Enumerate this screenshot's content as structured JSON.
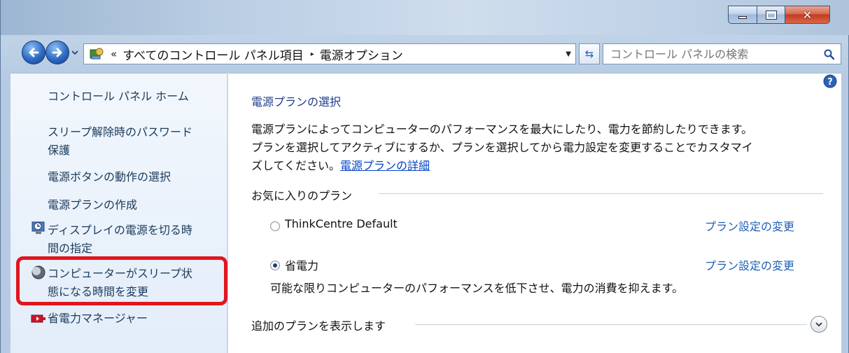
{
  "window": {
    "caption_buttons": [
      "minimize",
      "maximize",
      "close"
    ]
  },
  "address_bar": {
    "overflow_chevron": "«",
    "breadcrumbs": [
      "すべてのコントロール パネル項目",
      "電源オプション"
    ],
    "separator": "▸"
  },
  "search": {
    "placeholder": "コントロール パネルの検索"
  },
  "sidebar": {
    "items": [
      {
        "label": "コントロール パネル ホーム"
      },
      {
        "label_line1": "スリープ解除時のパスワード",
        "label_line2": "保護"
      },
      {
        "label": "電源ボタンの動作の選択"
      },
      {
        "label": "電源プランの作成"
      },
      {
        "label_line1": "ディスプレイの電源を切る時",
        "label_line2": "間の指定",
        "icon": "display-clock-icon"
      },
      {
        "label_line1": "コンピューターがスリープ状",
        "label_line2": "態になる時間を変更",
        "icon": "moon-sleep-icon",
        "highlighted": true
      },
      {
        "label": "省電力マネージャー",
        "icon": "battery-manager-icon"
      }
    ]
  },
  "main": {
    "title": "電源プランの選択",
    "description_line1": "電源プランによってコンピューターのパフォーマンスを最大にしたり、電力を節約したりできます。",
    "description_line2": "プランを選択してアクティブにするか、プランを選択してから電力設定を変更することでカスタマイ",
    "description_line3": "ズしてください。",
    "description_link": "電源プランの詳細",
    "favorites_title": "お気に入りのプラン",
    "plans": [
      {
        "name": "ThinkCentre Default",
        "selected": false,
        "link": "プラン設定の変更"
      },
      {
        "name": "省電力",
        "selected": true,
        "link": "プラン設定の変更",
        "description": "可能な限りコンピューターのパフォーマンスを低下させ、電力の消費を抑えます。"
      }
    ],
    "more_plans": "追加のプランを表示します"
  },
  "colors": {
    "highlight_border": "#e0151d",
    "link": "#1f5fb6",
    "title_blue": "#1f3c8c"
  }
}
